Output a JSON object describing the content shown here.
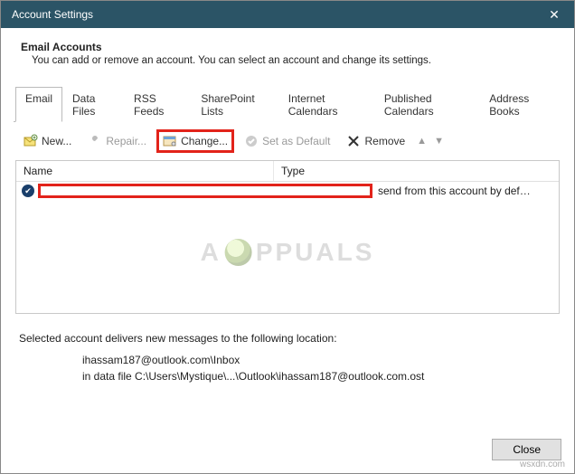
{
  "titlebar": {
    "title": "Account Settings"
  },
  "header": {
    "title": "Email Accounts",
    "description": "You can add or remove an account. You can select an account and change its settings."
  },
  "tabs": {
    "items": [
      {
        "label": "Email",
        "active": true
      },
      {
        "label": "Data Files"
      },
      {
        "label": "RSS Feeds"
      },
      {
        "label": "SharePoint Lists"
      },
      {
        "label": "Internet Calendars"
      },
      {
        "label": "Published Calendars"
      },
      {
        "label": "Address Books"
      }
    ]
  },
  "toolbar": {
    "new_label": "New...",
    "repair_label": "Repair...",
    "change_label": "Change...",
    "set_default_label": "Set as Default",
    "remove_label": "Remove"
  },
  "list": {
    "col_name": "Name",
    "col_type": "Type",
    "rows": [
      {
        "name_redacted": true,
        "type_text": "send from this account by def…"
      }
    ]
  },
  "location": {
    "intro": "Selected account delivers new messages to the following location:",
    "mailbox": "ihassam187@outlook.com\\Inbox",
    "datafile": "in data file C:\\Users\\Mystique\\...\\Outlook\\ihassam187@outlook.com.ost"
  },
  "footer": {
    "close_label": "Close"
  },
  "watermark_text": "PPUALS",
  "site_watermark": "wsxdn.com"
}
